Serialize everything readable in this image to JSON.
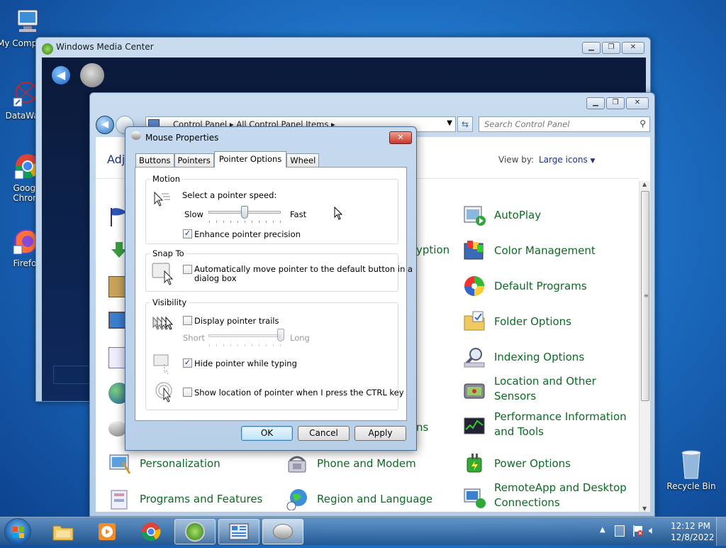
{
  "desktop": {
    "icons": [
      {
        "label": "My Comp"
      },
      {
        "label": "DataWag"
      },
      {
        "label": "Googl Chron"
      },
      {
        "label": "Firefo"
      },
      {
        "label": "Recycle Bin"
      }
    ]
  },
  "wmc": {
    "title": "Windows Media Center"
  },
  "cp": {
    "breadcrumb": "Control Panel  ▸  All Control Panel Items  ▸",
    "search_placeholder": "Search Control Panel",
    "heading_partial": "Adj",
    "view_by_label": "View by:",
    "view_by_value": "Large icons",
    "partial_item_1": "yption",
    "partial_item_2": "ns",
    "items": [
      {
        "label": "AutoPlay",
        "icon": "autoplay-icon"
      },
      {
        "label": "Color Management",
        "icon": "color-management-icon"
      },
      {
        "label": "Default Programs",
        "icon": "default-programs-icon"
      },
      {
        "label": "Folder Options",
        "icon": "folder-options-icon"
      },
      {
        "label": "Indexing Options",
        "icon": "indexing-options-icon"
      },
      {
        "label": "Location and Other Sensors",
        "icon": "location-sensors-icon"
      },
      {
        "label": "Performance Information and Tools",
        "icon": "performance-icon"
      },
      {
        "label": "Power Options",
        "icon": "power-options-icon"
      },
      {
        "label": "RemoteApp and Desktop Connections",
        "icon": "remoteapp-icon"
      },
      {
        "label": "Personalization",
        "icon": "personalization-icon"
      },
      {
        "label": "Programs and Features",
        "icon": "programs-features-icon"
      },
      {
        "label": "Phone and Modem",
        "icon": "phone-modem-icon"
      },
      {
        "label": "Region and Language",
        "icon": "region-language-icon"
      }
    ]
  },
  "dialog": {
    "title": "Mouse Properties",
    "tabs": [
      "Buttons",
      "Pointers",
      "Pointer Options",
      "Wheel"
    ],
    "active_tab": "Pointer Options",
    "motion": {
      "group_label": "Motion",
      "speed_label": "Select a pointer speed:",
      "slow": "Slow",
      "fast": "Fast",
      "speed_level": 0.5,
      "enhance_label": "Enhance pointer precision",
      "enhance_checked": true
    },
    "snap": {
      "group_label": "Snap To",
      "auto_label_1": "Automatically move pointer to the default button in a",
      "auto_label_2": "dialog box",
      "auto_checked": false
    },
    "visibility": {
      "group_label": "Visibility",
      "trails_label": "Display pointer trails",
      "trails_checked": false,
      "short": "Short",
      "long": "Long",
      "trails_level": 1.0,
      "hide_label": "Hide pointer while typing",
      "hide_checked": true,
      "ctrl_label": "Show location of pointer when I press the CTRL key",
      "ctrl_checked": false
    },
    "buttons": {
      "ok": "OK",
      "cancel": "Cancel",
      "apply": "Apply"
    }
  },
  "tray": {
    "time": "12:12 PM",
    "date": "12/8/2022"
  }
}
